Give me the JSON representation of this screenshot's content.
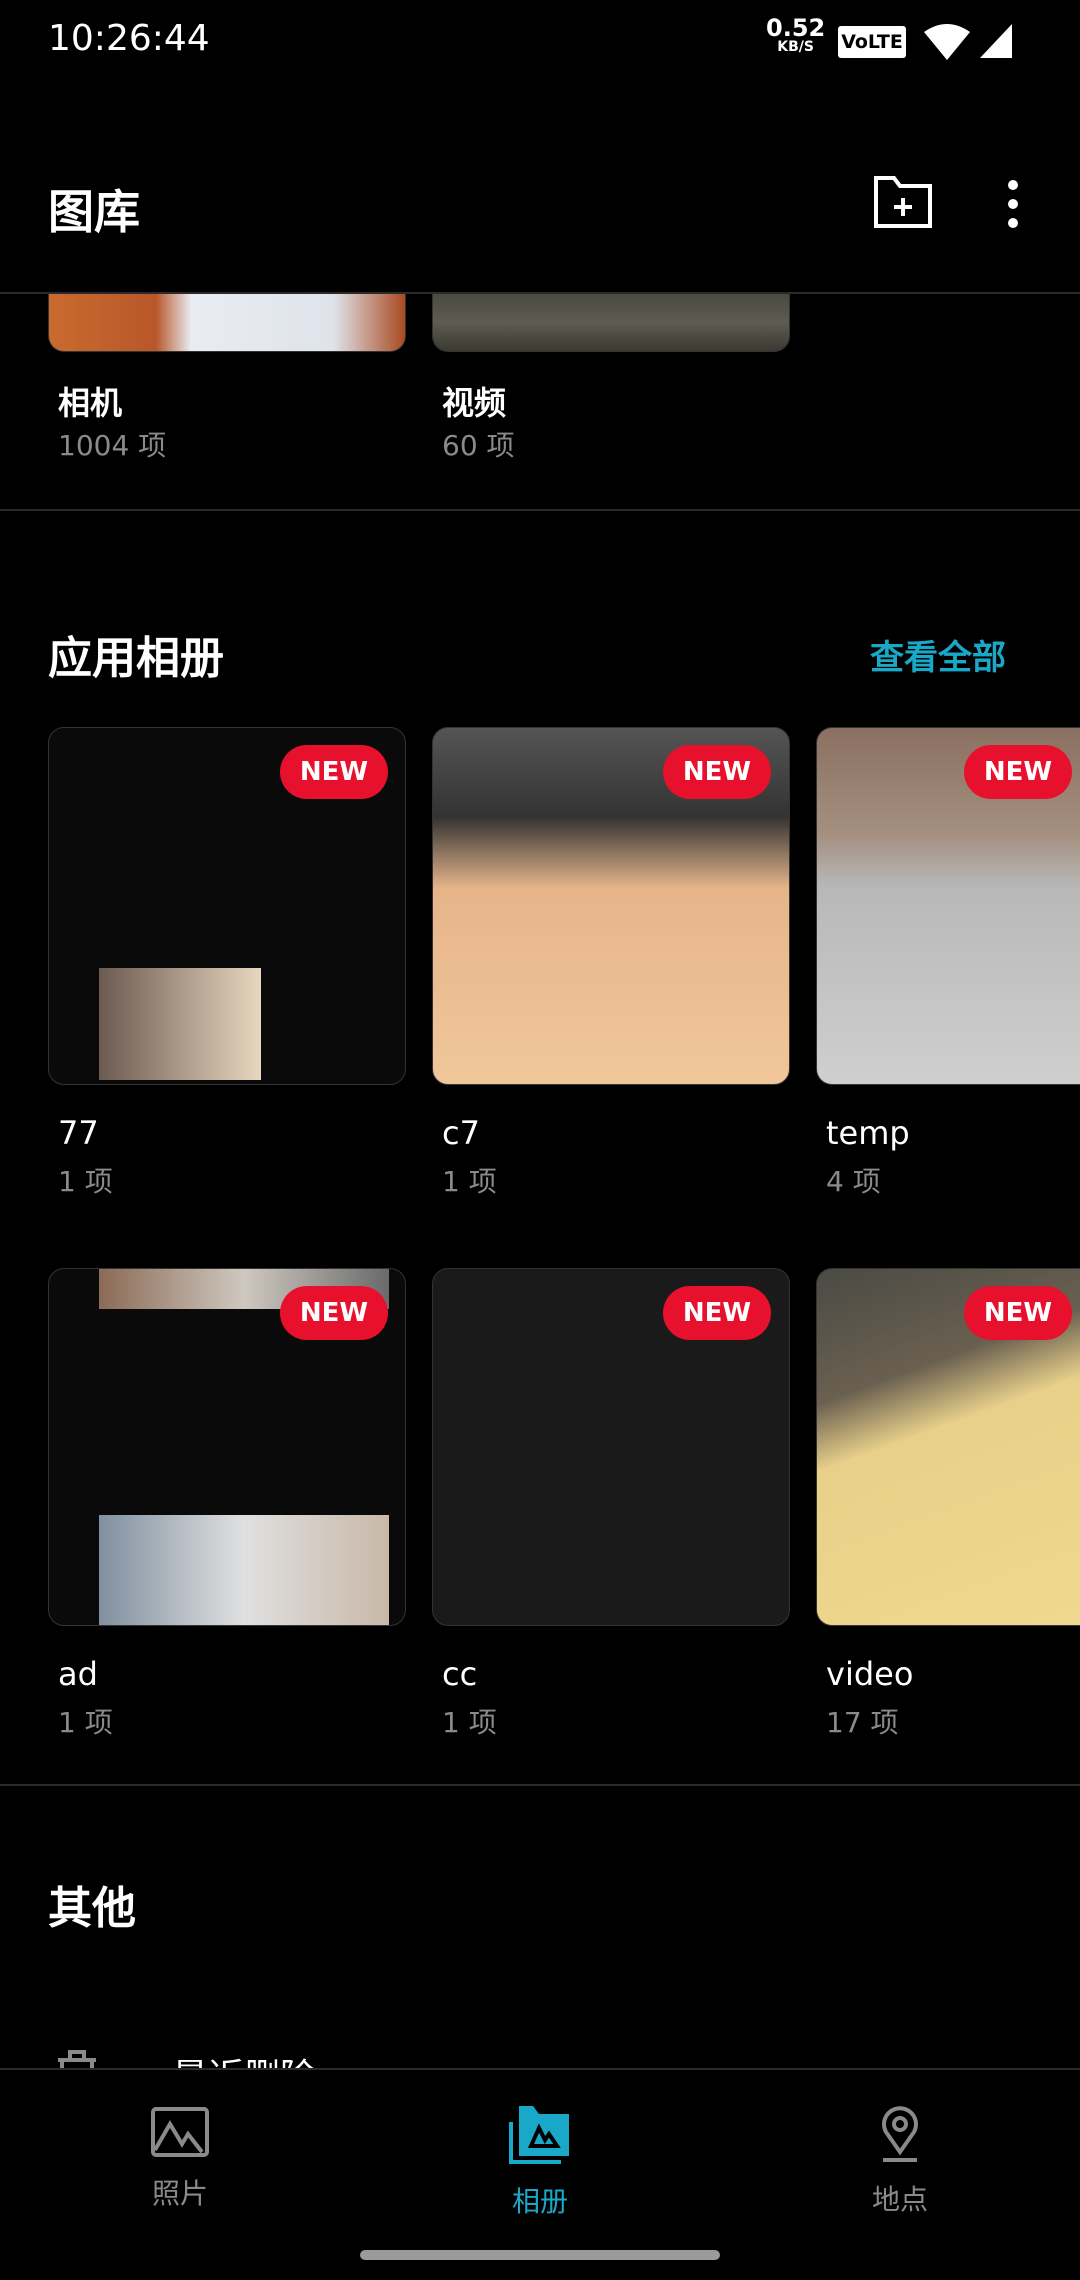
{
  "status_bar": {
    "time": "10:26:44",
    "net_speed": "0.52",
    "net_unit": "KB/S",
    "volte": "VoLTE",
    "wifi_icon": "wifi-icon",
    "signal_icon": "signal-icon"
  },
  "app_bar": {
    "title": "图库",
    "new_folder_icon": "folder-plus-icon",
    "more_icon": "more-vert-icon"
  },
  "top_albums": [
    {
      "name": "相机",
      "count": "1004 项"
    },
    {
      "name": "视频",
      "count": "60 项"
    }
  ],
  "app_albums": {
    "heading": "应用相册",
    "see_all": "查看全部",
    "badge": "NEW",
    "accent": "#1aa8c8",
    "badge_color": "#e8112d",
    "items": [
      {
        "name": "77",
        "count": "1 项",
        "new": true
      },
      {
        "name": "c7",
        "count": "1 项",
        "new": true
      },
      {
        "name": "temp",
        "count": "4 项",
        "new": true
      },
      {
        "name": "ad",
        "count": "1 项",
        "new": true
      },
      {
        "name": "cc",
        "count": "1 项",
        "new": true
      },
      {
        "name": "video",
        "count": "17 项",
        "new": true
      }
    ]
  },
  "other": {
    "heading": "其他",
    "items": [
      {
        "label": "最近删除",
        "icon": "trash-icon"
      }
    ]
  },
  "bottom_nav": {
    "items": [
      {
        "label": "照片",
        "icon": "photo-icon",
        "active": false
      },
      {
        "label": "相册",
        "icon": "album-icon",
        "active": true
      },
      {
        "label": "地点",
        "icon": "location-icon",
        "active": false
      }
    ]
  }
}
